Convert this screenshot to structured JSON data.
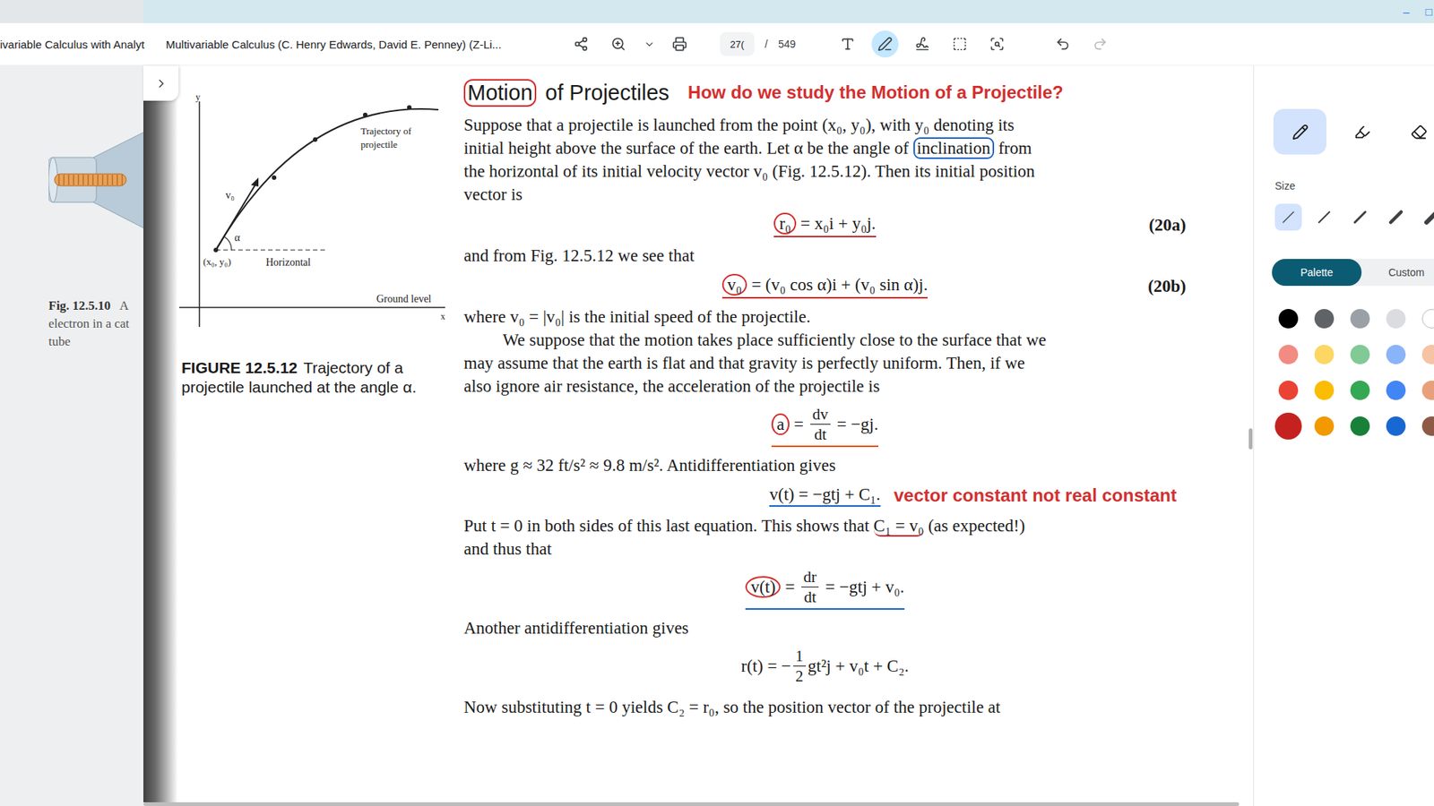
{
  "window": {
    "controls": [
      "–",
      "□"
    ]
  },
  "toolbar": {
    "tab_label": "ivariable Calculus with Analyt",
    "title": "Multivariable Calculus (C. Henry Edwards, David E. Penney) (Z-Li...",
    "page_field": "27(",
    "page_separator": "/",
    "page_total": "549",
    "tools_before": [
      {
        "selected": false,
        "disabled": false
      },
      {
        "selected": false,
        "disabled": false
      },
      {
        "selected": false,
        "disabled": false
      },
      {
        "selected": false,
        "disabled": false
      }
    ],
    "tools_after": [
      {
        "selected": false,
        "disabled": false
      },
      {
        "selected": true,
        "disabled": false
      },
      {
        "selected": false,
        "disabled": false
      },
      {
        "selected": false,
        "disabled": false
      },
      {
        "selected": false,
        "disabled": false
      },
      {
        "selected": false,
        "disabled": false
      },
      {
        "selected": false,
        "disabled": true
      }
    ]
  },
  "left_page": {
    "fig_label": "Fig. 12.5.10",
    "caption_lines": [
      "A",
      "electron in a cat",
      "tube"
    ]
  },
  "figure": {
    "axis_y": "y",
    "axis_x": "x",
    "trajectory_label": [
      "Trajectory of",
      "projectile"
    ],
    "velocity_label": "v₀",
    "angle_label": "α",
    "point_label": "(x₀, y₀)",
    "horizontal_label": "Horizontal",
    "ground_label": "Ground level",
    "caption_label": "FIGURE 12.5.12",
    "caption_lines": [
      "Trajectory of a",
      "projectile launched at the angle α."
    ]
  },
  "heading": {
    "words": [
      {
        "text": "Motion",
        "circled": true
      },
      {
        "text": "of Projectiles",
        "circled": false
      }
    ],
    "note": "How do we study the Motion of a Projectile?"
  },
  "blocks": [
    {
      "kind": "line",
      "indent": false,
      "segments": [
        {
          "kind": "text",
          "text": "Suppose that a projectile is launched from the point (x₀, y₀), with y₀ denoting its"
        }
      ]
    },
    {
      "kind": "line",
      "indent": false,
      "segments": [
        {
          "kind": "text",
          "text": "initial height above the surface of the earth. Let α be the angle of "
        },
        {
          "kind": "text",
          "text": "inclination",
          "boxed": true
        },
        {
          "kind": "text",
          "text": " from"
        }
      ]
    },
    {
      "kind": "line",
      "indent": false,
      "segments": [
        {
          "kind": "text",
          "text": "the horizontal of its initial velocity vector v₀ (Fig. 12.5.12). Then its initial position"
        }
      ]
    },
    {
      "kind": "line",
      "indent": false,
      "segments": [
        {
          "kind": "text",
          "text": "vector is"
        }
      ]
    },
    {
      "kind": "eq",
      "underline": "#c62828",
      "number": "(20a)",
      "note": "",
      "segments": [
        {
          "kind": "text",
          "text": "r₀",
          "circled": true
        },
        {
          "kind": "text",
          "text": " = x₀i + y₀j."
        }
      ]
    },
    {
      "kind": "line",
      "indent": false,
      "segments": [
        {
          "kind": "text",
          "text": "and from Fig. 12.5.12 we see that"
        }
      ]
    },
    {
      "kind": "eq",
      "underline": "#c62828",
      "number": "(20b)",
      "note": "",
      "segments": [
        {
          "kind": "text",
          "text": "v₀",
          "circled": true
        },
        {
          "kind": "text",
          "text": " = (v₀ cos α)i + (v₀ sin α)j."
        }
      ]
    },
    {
      "kind": "line",
      "indent": false,
      "segments": [
        {
          "kind": "text",
          "text": "where v₀ = |v₀| is the initial speed of the projectile."
        }
      ]
    },
    {
      "kind": "line",
      "indent": true,
      "segments": [
        {
          "kind": "text",
          "text": "We suppose that the motion takes place sufficiently close to the surface that we"
        }
      ]
    },
    {
      "kind": "line",
      "indent": false,
      "segments": [
        {
          "kind": "text",
          "text": "may assume that the earth is flat and that gravity is perfectly uniform. Then, if we"
        }
      ]
    },
    {
      "kind": "line",
      "indent": false,
      "segments": [
        {
          "kind": "text",
          "text": "also ignore air resistance, the acceleration of the projectile is"
        }
      ]
    },
    {
      "kind": "eq",
      "underline": "#e65100",
      "number": "",
      "note": "",
      "segments": [
        {
          "kind": "text",
          "text": "a",
          "circled": true
        },
        {
          "kind": "text",
          "text": " = "
        },
        {
          "kind": "frac",
          "num": "dv",
          "den": "dt"
        },
        {
          "kind": "text",
          "text": " = −gj."
        }
      ]
    },
    {
      "kind": "line",
      "indent": false,
      "segments": [
        {
          "kind": "text",
          "text": "where g ≈ 32 ft/s² ≈ 9.8 m/s². Antidifferentiation gives"
        }
      ]
    },
    {
      "kind": "eq",
      "underline": "#1565c0",
      "number": "",
      "note": "vector constant not real constant",
      "segments": [
        {
          "kind": "text",
          "text": "v(t) = −gtj + C₁."
        }
      ]
    },
    {
      "kind": "line",
      "indent": false,
      "segments": [
        {
          "kind": "text",
          "text": "Put t = 0 in both sides of this last equation. This shows that "
        },
        {
          "kind": "text",
          "text": "C₁ = v₀",
          "underline": "#c62828"
        },
        {
          "kind": "text",
          "text": " (as expected!)"
        }
      ]
    },
    {
      "kind": "line",
      "indent": false,
      "segments": [
        {
          "kind": "text",
          "text": "and thus that"
        }
      ]
    },
    {
      "kind": "eq",
      "underline": "#1565c0",
      "number": "",
      "note": "",
      "segments": [
        {
          "kind": "text",
          "text": "v(t)",
          "circled": true
        },
        {
          "kind": "text",
          "text": " = "
        },
        {
          "kind": "frac",
          "num": "dr",
          "den": "dt"
        },
        {
          "kind": "text",
          "text": " = −gtj + v₀."
        }
      ]
    },
    {
      "kind": "line",
      "indent": false,
      "segments": [
        {
          "kind": "text",
          "text": "Another antidifferentiation gives"
        }
      ]
    },
    {
      "kind": "eq",
      "underline": "",
      "number": "",
      "note": "",
      "segments": [
        {
          "kind": "text",
          "text": "r(t) = −"
        },
        {
          "kind": "frac",
          "num": "1",
          "den": "2"
        },
        {
          "kind": "text",
          "text": "gt²j + v₀t + C₂."
        }
      ]
    },
    {
      "kind": "line",
      "indent": false,
      "segments": [
        {
          "kind": "text",
          "text": "Now substituting t = 0 yields C₂ = r₀, so the position vector of the projectile at"
        }
      ]
    }
  ],
  "scrollbar": {
    "level": 0.49
  },
  "panel": {
    "pen_tools": [
      {
        "selected": true
      },
      {
        "selected": false
      },
      {
        "selected": false
      }
    ],
    "size_label": "Size",
    "sizes": [
      {
        "selected": true
      },
      {
        "selected": false
      },
      {
        "selected": false
      },
      {
        "selected": false
      },
      {
        "selected": false
      }
    ],
    "palette_tabs": [
      {
        "label": "Palette",
        "selected": true
      },
      {
        "label": "Custom",
        "selected": false
      }
    ],
    "colors": [
      {
        "color": "#000000",
        "selected": false
      },
      {
        "color": "#5f6368",
        "selected": false
      },
      {
        "color": "#9aa0a6",
        "selected": false
      },
      {
        "color": "#dadce0",
        "selected": false
      },
      {
        "color": "#ffffff",
        "selected": false
      },
      {
        "color": "#f28b82",
        "selected": false
      },
      {
        "color": "#fdd663",
        "selected": false
      },
      {
        "color": "#81c995",
        "selected": false
      },
      {
        "color": "#8ab4f8",
        "selected": false
      },
      {
        "color": "#f6c3a4",
        "selected": false
      },
      {
        "color": "#ea4335",
        "selected": false
      },
      {
        "color": "#fbbc04",
        "selected": false
      },
      {
        "color": "#34a853",
        "selected": false
      },
      {
        "color": "#4285f4",
        "selected": false
      },
      {
        "color": "#e8a07c",
        "selected": false
      },
      {
        "color": "#c5221f",
        "selected": true
      },
      {
        "color": "#f29900",
        "selected": false
      },
      {
        "color": "#188038",
        "selected": false
      },
      {
        "color": "#1967d2",
        "selected": false
      },
      {
        "color": "#8d5a45",
        "selected": false
      }
    ]
  }
}
